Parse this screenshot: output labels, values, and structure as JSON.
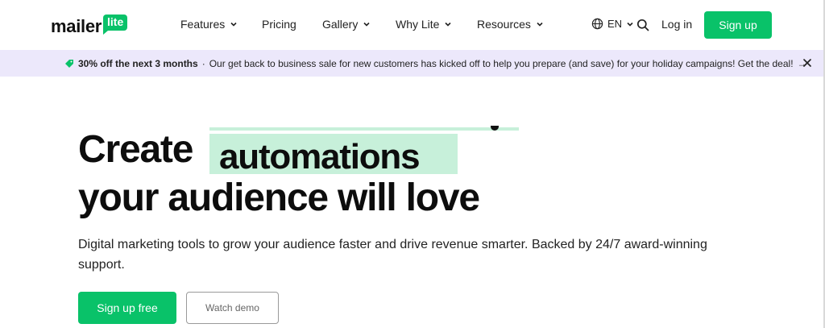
{
  "header": {
    "logo_text": "mailer",
    "logo_badge": "lite",
    "nav": [
      {
        "label": "Features",
        "has_dropdown": true
      },
      {
        "label": "Pricing",
        "has_dropdown": false
      },
      {
        "label": "Gallery",
        "has_dropdown": true
      },
      {
        "label": "Why Lite",
        "has_dropdown": true
      },
      {
        "label": "Resources",
        "has_dropdown": true
      }
    ],
    "language": "EN",
    "login_label": "Log in",
    "signup_label": "Sign up"
  },
  "banner": {
    "highlight": "30% off the next 3 months",
    "separator": "·",
    "message": "Our get back to business sale for new customers has kicked off to help you prepare (and save) for your holiday campaigns! Get the deal!",
    "arrow": "→"
  },
  "hero": {
    "title_start": "Create",
    "title_highlight": "automations",
    "title_end": "your audience will love",
    "subtitle": "Digital marketing tools to grow your audience faster and drive revenue smarter. Backed by 24/7 award-winning support.",
    "primary_cta": "Sign up free",
    "secondary_cta": "Watch demo"
  },
  "colors": {
    "brand_green": "#09c269",
    "highlight_green": "#c7f0da",
    "banner_bg": "#ece8fb"
  },
  "icons": {
    "banner_tag": "tag-icon",
    "language": "globe-icon",
    "search": "search-icon",
    "close": "close-icon",
    "dropdown": "chevron-down-icon"
  }
}
